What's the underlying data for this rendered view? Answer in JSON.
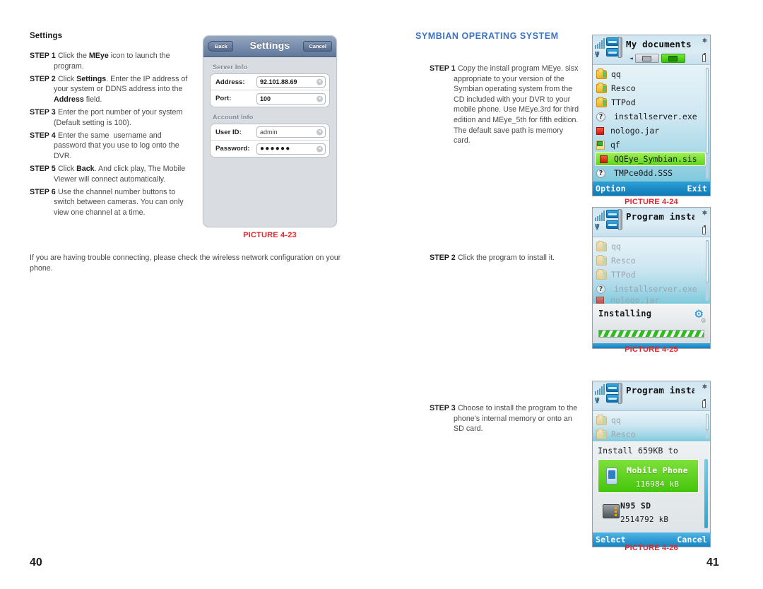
{
  "left_page": {
    "section_title": "Settings",
    "steps": [
      {
        "label": "STEP 1",
        "text": ". Click the MEye icon to launch the program."
      },
      {
        "label": "STEP 2",
        "text": ". Click Settings. Enter the IP address of your system or DDNS address into the Address field."
      },
      {
        "label": "STEP 3",
        "text": ". Enter the port number of your system (Default setting is 100)."
      },
      {
        "label": "STEP 4",
        "text": ". Enter the same  username and password that you use to log onto the DVR."
      },
      {
        "label": "STEP 5",
        "text": ". Click Back. And click play, The Mobile Viewer will connect automatically."
      },
      {
        "label": "STEP 6",
        "text": ". Use the channel number buttons to switch between cameras. You can only view one channel at a time."
      }
    ],
    "footnote": "If you are having trouble connecting, please check the wireless network configuration on your phone.",
    "page_number": "40"
  },
  "iphone": {
    "back_label": "Back",
    "title": "Settings",
    "cancel_label": "Cancel",
    "group1_label": "Server Info",
    "group2_label": "Account Info",
    "rows": [
      {
        "label": "Address:",
        "value": "92.101.88.69"
      },
      {
        "label": "Port:",
        "value": "100"
      },
      {
        "label": "User ID:",
        "value": "admin"
      },
      {
        "label": "Password:",
        "value": "●●●●●●"
      }
    ],
    "clear_icon": "×",
    "caption": "PICTURE 4-23"
  },
  "right_page": {
    "heading": "SYMBIAN OPERATING SYSTEM",
    "steps": [
      {
        "label": "STEP 1",
        "text": ". Copy the install program MEye. sisx appropriate to your version of the Symbian operating system from the CD included with your DVR to your mobile phone. Use MEye.3rd for third edition and MEye_5th for fifth edition. The default save path is memory card."
      },
      {
        "label": "STEP 2",
        "text": ". Click the program to install it."
      },
      {
        "label": "STEP 3",
        "text": ". Choose to install the program to the phone's internal memory or onto an SD card."
      }
    ],
    "page_number": "41"
  },
  "phone1": {
    "title": "My documents",
    "tab_arrow": "◄",
    "items": [
      {
        "icon": "folder-icon",
        "label": "qq",
        "selected": false
      },
      {
        "icon": "folder-icon",
        "label": "Resco",
        "selected": false
      },
      {
        "icon": "folder-icon",
        "label": "TTPod",
        "selected": false
      },
      {
        "icon": "unknown-file-icon",
        "label": "installserver.exe",
        "selected": false
      },
      {
        "icon": "jar-file-icon",
        "label": "nologo.jar",
        "selected": false
      },
      {
        "icon": "note-file-icon",
        "label": "qf",
        "selected": false
      },
      {
        "icon": "sis-file-icon",
        "label": "QQEye_Symbian.sis",
        "selected": true
      },
      {
        "icon": "unknown-file-icon",
        "label": "TMPce0dd.SSS",
        "selected": false
      }
    ],
    "question_glyph": "?",
    "softkey_left": "Option",
    "softkey_right": "Exit",
    "caption": "PICTURE 4-24"
  },
  "phone2": {
    "title": "Program install",
    "items": [
      {
        "icon": "folder-icon",
        "label": "qq"
      },
      {
        "icon": "folder-icon",
        "label": "Resco"
      },
      {
        "icon": "folder-icon",
        "label": "TTPod"
      },
      {
        "icon": "unknown-file-icon",
        "label": "installserver.exe"
      },
      {
        "icon": "jar-file-icon",
        "label": "nologo.jar"
      }
    ],
    "question_glyph": "?",
    "dialog_title": "Installing",
    "gear_glyph": "⚙",
    "gear_glyph_small": "⚙",
    "caption": "PICTURE 4-25"
  },
  "phone3": {
    "title": "Program install",
    "items": [
      {
        "icon": "folder-icon",
        "label": "qq"
      },
      {
        "icon": "folder-icon",
        "label": "Resco"
      }
    ],
    "dialog_title": "Install 659KB to",
    "options": [
      {
        "icon": "mobile-phone-icon",
        "name": "Mobile Phone",
        "size": "116984 kB",
        "selected": true
      },
      {
        "icon": "sd-card-icon",
        "name": "N95 SD",
        "size": "2514792 kB",
        "selected": false
      }
    ],
    "softkey_left": "Select",
    "softkey_right": "Cancel",
    "caption": "PICTURE 4-26"
  },
  "colors": {
    "heading_blue": "#3b72c4",
    "caption_red": "#e8242a",
    "symbian_select_green": "#5fd616",
    "softbar_blue": "#1785c2"
  }
}
